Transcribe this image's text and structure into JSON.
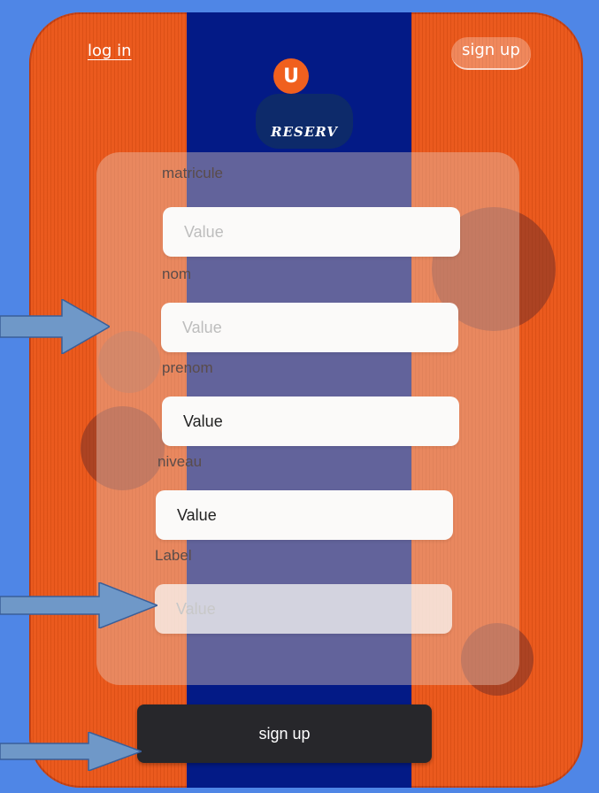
{
  "header": {
    "login_link": "log in",
    "signup_link": "sign up"
  },
  "logo": {
    "letter": "U",
    "name": "RESERV"
  },
  "form": {
    "fields": [
      {
        "label": "matricule",
        "value": "Value",
        "state": "placeholder"
      },
      {
        "label": "nom",
        "value": "Value",
        "state": "placeholder"
      },
      {
        "label": "prenom",
        "value": "Value",
        "state": "filled"
      },
      {
        "label": "niveau",
        "value": "Value",
        "state": "filled"
      },
      {
        "label": "Label",
        "value": "Value",
        "state": "faded"
      }
    ],
    "submit_label": "sign up"
  },
  "colors": {
    "background": "#4f86e6",
    "phone": "#ea5517",
    "stripe": "#031a86",
    "button": "#27272b",
    "arrow": "#6f98c8"
  }
}
